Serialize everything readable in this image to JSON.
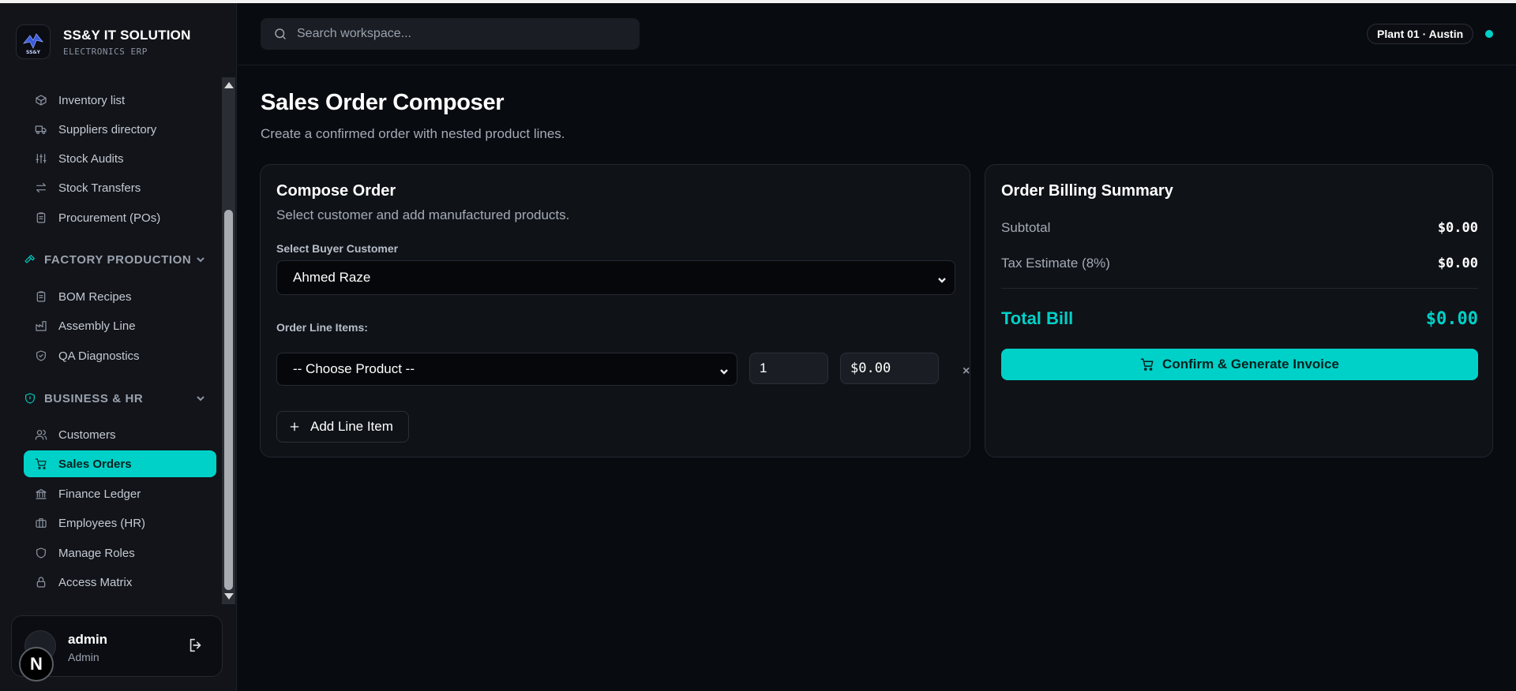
{
  "brand": {
    "title": "SS&Y IT SOLUTION",
    "subtitle": "ELECTRONICS ERP",
    "logo_text": "SS&Y"
  },
  "header": {
    "search_placeholder": "Search workspace...",
    "plant": "Plant 01 · Austin",
    "status_color": "#00d1c8"
  },
  "sidebar": {
    "inventory_items": [
      {
        "label": "Inventory list",
        "icon": "package-icon"
      },
      {
        "label": "Suppliers directory",
        "icon": "truck-icon"
      },
      {
        "label": "Stock Audits",
        "icon": "sliders-icon"
      },
      {
        "label": "Stock Transfers",
        "icon": "arrows-left-right-icon"
      },
      {
        "label": "Procurement (POs)",
        "icon": "clipboard-icon"
      }
    ],
    "sections": {
      "factory": {
        "label": "FACTORY PRODUCTION",
        "icon": "hammer-icon"
      },
      "business": {
        "label": "BUSINESS & HR",
        "icon": "shield-icon"
      }
    },
    "factory_items": [
      {
        "label": "BOM Recipes",
        "icon": "clipboard-icon"
      },
      {
        "label": "Assembly Line",
        "icon": "factory-icon"
      },
      {
        "label": "QA Diagnostics",
        "icon": "shield-check-icon"
      }
    ],
    "business_items": [
      {
        "label": "Customers",
        "icon": "users-icon"
      },
      {
        "label": "Sales Orders",
        "icon": "cart-icon",
        "active": true
      },
      {
        "label": "Finance Ledger",
        "icon": "bank-icon"
      },
      {
        "label": "Employees (HR)",
        "icon": "briefcase-icon"
      },
      {
        "label": "Manage Roles",
        "icon": "shield-icon"
      },
      {
        "label": "Access Matrix",
        "icon": "lock-icon"
      }
    ]
  },
  "user": {
    "name": "admin",
    "role": "Admin",
    "badge": "N"
  },
  "page": {
    "title": "Sales Order Composer",
    "subtitle": "Create a confirmed order with nested product lines."
  },
  "compose": {
    "title": "Compose Order",
    "subtitle": "Select customer and add manufactured products.",
    "customer_label": "Select Buyer Customer",
    "customer_value": "Ahmed Raze",
    "lines_label": "Order Line Items:",
    "line": {
      "product": "-- Choose Product --",
      "qty": "1",
      "price": "$0.00",
      "remove": "×"
    },
    "add_label": "Add Line Item"
  },
  "summary": {
    "title": "Order Billing Summary",
    "subtotal_label": "Subtotal",
    "subtotal_value": "$0.00",
    "tax_label": "Tax Estimate (8%)",
    "tax_value": "$0.00",
    "total_label": "Total Bill",
    "total_value": "$0.00",
    "confirm_label": "Confirm & Generate Invoice"
  },
  "colors": {
    "accent": "#00d1c8",
    "background": "#080b10",
    "sidebar": "#121419"
  }
}
